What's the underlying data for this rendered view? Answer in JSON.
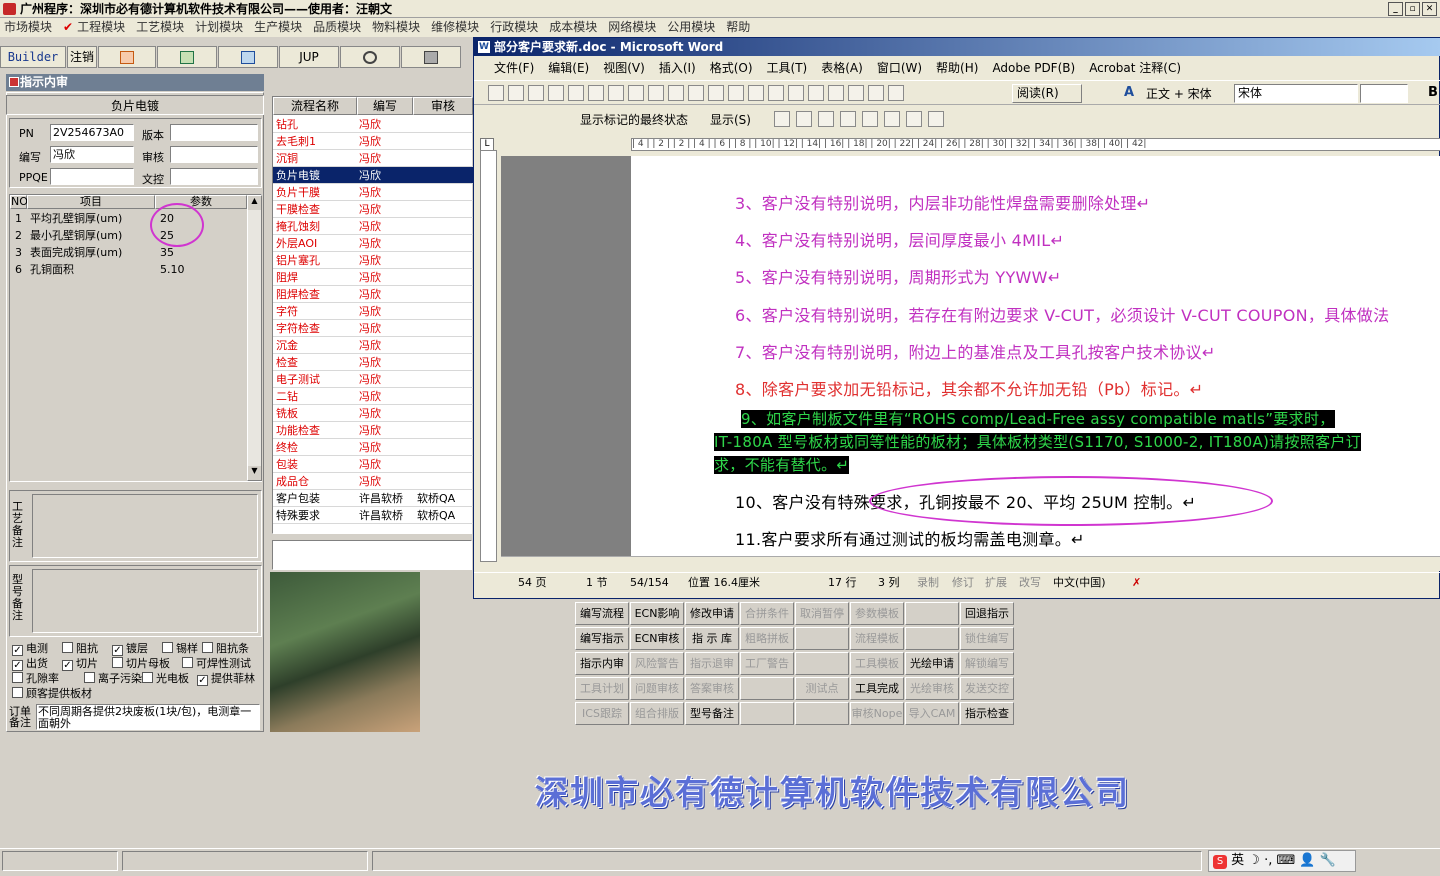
{
  "app": {
    "title": "广州程序：深圳市必有德计算机软件技术有限公司——使用者：汪朝文",
    "menu": [
      "市场模块",
      "工程模块",
      "工艺模块",
      "计划模块",
      "生产模块",
      "品质模块",
      "物料模块",
      "维修模块",
      "行政模块",
      "成本模块",
      "网络模块",
      "公用模块",
      "帮助"
    ]
  },
  "toolbar": {
    "builder": "Builder",
    "logout": "注销",
    "jup": "JUP"
  },
  "panel": {
    "header": "指示内审",
    "board_title": "负片电镀",
    "pn_label": "PN",
    "pn_value": "2V254673A0",
    "version_label": "版本",
    "version_value": "",
    "editor_label": "编写",
    "editor_value": "冯欣",
    "review_label": "审核",
    "review_value": "",
    "ppqe_label": "PPQE",
    "ppqe_value": "",
    "doc_label": "文控",
    "doc_value": "",
    "grid_headers": [
      "NO",
      "项目",
      "参数"
    ],
    "params": [
      {
        "no": "1",
        "item": "平均孔壁铜厚(um)",
        "value": "20"
      },
      {
        "no": "2",
        "item": "最小孔壁铜厚(um)",
        "value": "25"
      },
      {
        "no": "3",
        "item": "表面完成铜厚(um)",
        "value": "35"
      },
      {
        "no": "6",
        "item": "孔铜面积",
        "value": "5.10"
      }
    ],
    "craft_note_label": "工艺备注",
    "model_note_label": "型号备注",
    "order_note_label": "订单备注",
    "order_note_value": "不同周期各提供2块废板(1块/包)，电测章一面朝外"
  },
  "checkboxes": [
    {
      "label": "电测",
      "checked": true
    },
    {
      "label": "阻抗",
      "checked": false
    },
    {
      "label": "镀层",
      "checked": true
    },
    {
      "label": "锡样",
      "checked": false
    },
    {
      "label": "阻抗条",
      "checked": false
    },
    {
      "label": "出货",
      "checked": true
    },
    {
      "label": "切片",
      "checked": true
    },
    {
      "label": "切片母板",
      "checked": false
    },
    {
      "label": "可焊性测试",
      "checked": false
    },
    {
      "label": "孔隙率",
      "checked": false
    },
    {
      "label": "离子污染",
      "checked": false
    },
    {
      "label": "光电板",
      "checked": false
    },
    {
      "label": "提供菲林",
      "checked": true
    },
    {
      "label": "顾客提供板材",
      "checked": false
    }
  ],
  "process": {
    "headers": [
      "流程名称",
      "编写",
      "审核"
    ],
    "rows": [
      {
        "name": "钻孔",
        "editor": "冯欣",
        "reviewer": ""
      },
      {
        "name": "去毛刺1",
        "editor": "冯欣",
        "reviewer": ""
      },
      {
        "name": "沉铜",
        "editor": "冯欣",
        "reviewer": ""
      },
      {
        "name": "负片电镀",
        "editor": "冯欣",
        "reviewer": ""
      },
      {
        "name": "负片干膜",
        "editor": "冯欣",
        "reviewer": ""
      },
      {
        "name": "干膜检查",
        "editor": "冯欣",
        "reviewer": ""
      },
      {
        "name": "掩孔蚀刻",
        "editor": "冯欣",
        "reviewer": ""
      },
      {
        "name": "外层AOI",
        "editor": "冯欣",
        "reviewer": ""
      },
      {
        "name": "铝片塞孔",
        "editor": "冯欣",
        "reviewer": ""
      },
      {
        "name": "阻焊",
        "editor": "冯欣",
        "reviewer": ""
      },
      {
        "name": "阻焊检查",
        "editor": "冯欣",
        "reviewer": ""
      },
      {
        "name": "字符",
        "editor": "冯欣",
        "reviewer": ""
      },
      {
        "name": "字符检查",
        "editor": "冯欣",
        "reviewer": ""
      },
      {
        "name": "沉金",
        "editor": "冯欣",
        "reviewer": ""
      },
      {
        "name": "检查",
        "editor": "冯欣",
        "reviewer": ""
      },
      {
        "name": "电子测试",
        "editor": "冯欣",
        "reviewer": ""
      },
      {
        "name": "二钻",
        "editor": "冯欣",
        "reviewer": ""
      },
      {
        "name": "铣板",
        "editor": "冯欣",
        "reviewer": ""
      },
      {
        "name": "功能检查",
        "editor": "冯欣",
        "reviewer": ""
      },
      {
        "name": "终检",
        "editor": "冯欣",
        "reviewer": ""
      },
      {
        "name": "包装",
        "editor": "冯欣",
        "reviewer": ""
      },
      {
        "name": "成品仓",
        "editor": "冯欣",
        "reviewer": ""
      },
      {
        "name": "客户包装",
        "editor": "许昌软桥",
        "reviewer": "软桥QA"
      },
      {
        "name": "特殊要求",
        "editor": "许昌软桥",
        "reviewer": "软桥QA"
      }
    ]
  },
  "commands": [
    [
      "编写流程",
      "ECN影响",
      "修改申请",
      "合拼条件",
      "取消暂停",
      "参数模板",
      "",
      "回退指示"
    ],
    [
      "编写指示",
      "ECN审核",
      "指 示 库",
      "粗略拼板",
      "",
      "流程模板",
      "",
      "锁住编写"
    ],
    [
      "指示内审",
      "风险警告",
      "指示退审",
      "工厂警告",
      "",
      "工具模板",
      "光绘申请",
      "解锁编写"
    ],
    [
      "工具计划",
      "问题审核",
      "答案审核",
      "",
      "测试点",
      "工具完成",
      "光绘审核",
      "发送交控"
    ],
    [
      "ICS跟踪",
      "组合排版",
      "型号备注",
      "",
      "",
      "审核Nope",
      "导入CAM",
      "指示检查"
    ]
  ],
  "word": {
    "title": "部分客户要求新.doc - Microsoft Word",
    "menu": [
      "文件(F)",
      "编辑(E)",
      "视图(V)",
      "插入(I)",
      "格式(O)",
      "工具(T)",
      "表格(A)",
      "窗口(W)",
      "帮助(H)",
      "Adobe PDF(B)",
      "Acrobat 注释(C)"
    ],
    "style": "正文 + 宋体",
    "font": "宋体",
    "read_btn": "阅读(R)",
    "markup_state": "显示标记的最终状态",
    "show_btn": "显示(S)",
    "ruler_text": "| 4 | | 2 |   | 2 |   | 4 |   | 6 |   | 8 |   | 10|   | 12|   | 14|   | 16|   | 18|   | 20|   | 22|   | 24|   | 26|   | 28|   | 30|   | 32|   | 34|   | 36|   | 38|   | 40|   | 42|",
    "lines": [
      "3、客户没有特别说明，内层非功能性焊盘需要删除处理↵",
      "4、客户没有特别说明，层间厚度最小 4MIL↵",
      "5、客户没有特别说明，周期形式为 YYWW↵",
      "6、客户没有特别说明，若存在有附边要求 V-CUT，必须设计 V-CUT COUPON，具体做法",
      "7、客户没有特别说明，附边上的基准点及工具孔按客户技术协议↵",
      "8、除客户要求加无铅标记，其余都不允许加无铅（Pb）标记。↵",
      "9、如客户制板文件里有“ROHS comp/Lead-Free assy compatible matls”要求时，",
      "IT-180A 型号板材或同等性能的板材；具体板材类型(S1170, S1000-2, IT180A)请按照客户订",
      "求，不能有替代。↵",
      "10、客户没有特殊要求，孔铜按最不 20、平均 25UM 控制。↵",
      "11.客户要求所有通过测试的板均需盖电测章。↵"
    ],
    "status": {
      "page": "54 页",
      "section": "1 节",
      "pages": "54/154",
      "pos": "位置 16.4厘米",
      "line": "17 行",
      "col": "3 列",
      "rec": "录制",
      "rev": "修订",
      "ext": "扩展",
      "ovr": "改写",
      "lang": "中文(中国)"
    }
  },
  "banner": "深圳市必有德计算机软件技术有限公司",
  "ime": {
    "label": "英"
  },
  "colors": {
    "title_blue": "#0a246a",
    "red_text": "#d00000",
    "magenta_text": "#c030c0",
    "highlight_green": "#2fd64a",
    "banner_blue": "#5b6fd6"
  }
}
